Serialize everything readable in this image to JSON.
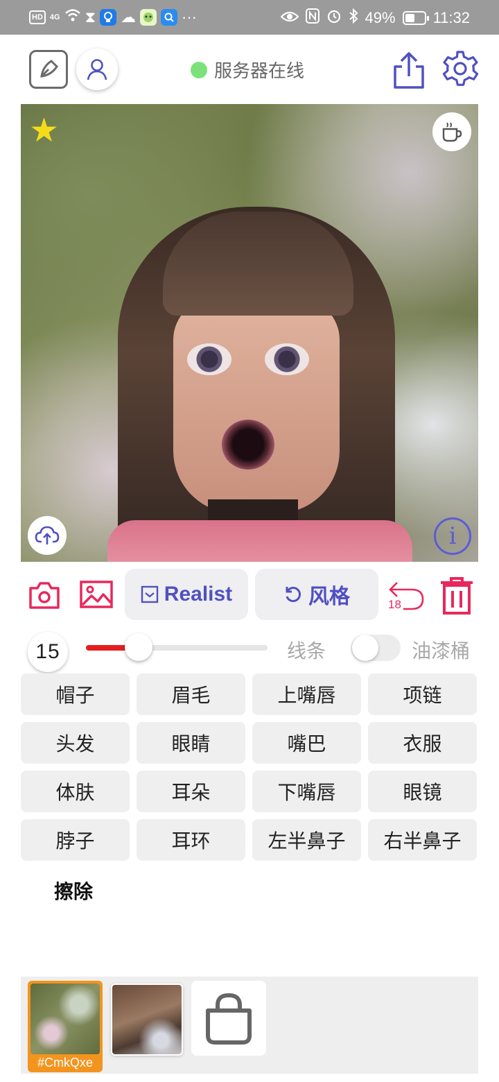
{
  "status_bar": {
    "hd": "HD",
    "signal": "4G",
    "battery": "49%",
    "time": "11:32",
    "more": "···",
    "icons": [
      "hd-icon",
      "signal-icon",
      "wifi-icon",
      "hourglass-icon",
      "bulb-app-icon",
      "cloud-icon",
      "avatar-app-icon",
      "search-app-icon",
      "eye-icon",
      "nfc-icon",
      "alarm-icon",
      "bluetooth-icon",
      "battery-icon"
    ]
  },
  "header": {
    "server_status": "服务器在线",
    "status_color": "#7be27b",
    "icons": [
      "edit-icon",
      "user-icon",
      "share-icon",
      "gear-icon"
    ]
  },
  "canvas": {
    "icons": [
      "star-icon",
      "coffee-cup-icon",
      "cloud-upload-icon",
      "info-icon"
    ],
    "info_glyph": "i"
  },
  "toolbar": {
    "model_label": "Realist",
    "style_label": "风格",
    "undo_count": "18",
    "accent_color": "#e8285c",
    "pill_text_color": "#5050c2",
    "icons": [
      "camera-icon",
      "image-icon",
      "checkbox-icon",
      "rotate-icon",
      "undo-icon",
      "trash-icon"
    ]
  },
  "brush": {
    "size": "15",
    "slider_fraction": 0.29,
    "line_label": "线条",
    "bucket_label": "油漆桶",
    "bucket_toggle_on": false,
    "slider_color": "#e41e1e"
  },
  "parts": [
    "帽子",
    "眉毛",
    "上嘴唇",
    "项链",
    "头发",
    "眼睛",
    "嘴巴",
    "衣服",
    "体肤",
    "耳朵",
    "下嘴唇",
    "眼镜",
    "脖子",
    "耳环",
    "左半鼻子",
    "右半鼻子"
  ],
  "erase_label": "擦除",
  "tray": {
    "selected_tag": "#CmkQxe",
    "selected_color": "#f3941e",
    "icons": [
      "shopping-bag-icon"
    ]
  }
}
